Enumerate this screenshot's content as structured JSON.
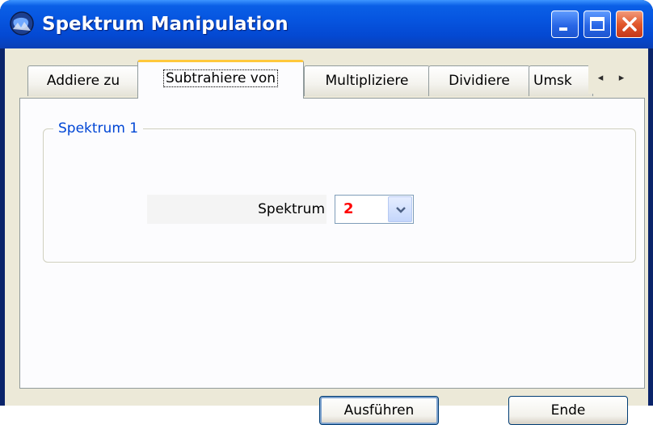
{
  "window": {
    "title": "Spektrum Manipulation",
    "icons": {
      "app": "globe-icon",
      "minimize": "minimize-icon",
      "maximize": "maximize-icon",
      "close": "close-icon"
    },
    "colors": {
      "title_bar": "#0a5fe6",
      "close_button": "#e2582b"
    }
  },
  "tabs": [
    {
      "label": "Addiere zu",
      "active": false
    },
    {
      "label": "Subtrahiere von",
      "active": true
    },
    {
      "label": "Multipliziere",
      "active": false
    },
    {
      "label": "Dividiere",
      "active": false
    },
    {
      "label": "Umsk",
      "active": false
    }
  ],
  "tab_scroll": {
    "left_icon": "chevron-left-icon",
    "right_icon": "chevron-right-icon",
    "left_glyph": "◂",
    "right_glyph": "▸"
  },
  "group": {
    "label": "Spektrum 1"
  },
  "field": {
    "label": "Spektrum",
    "value": "2",
    "value_color": "#ff0000"
  },
  "buttons": {
    "run": "Ausführen",
    "end": "Ende"
  }
}
